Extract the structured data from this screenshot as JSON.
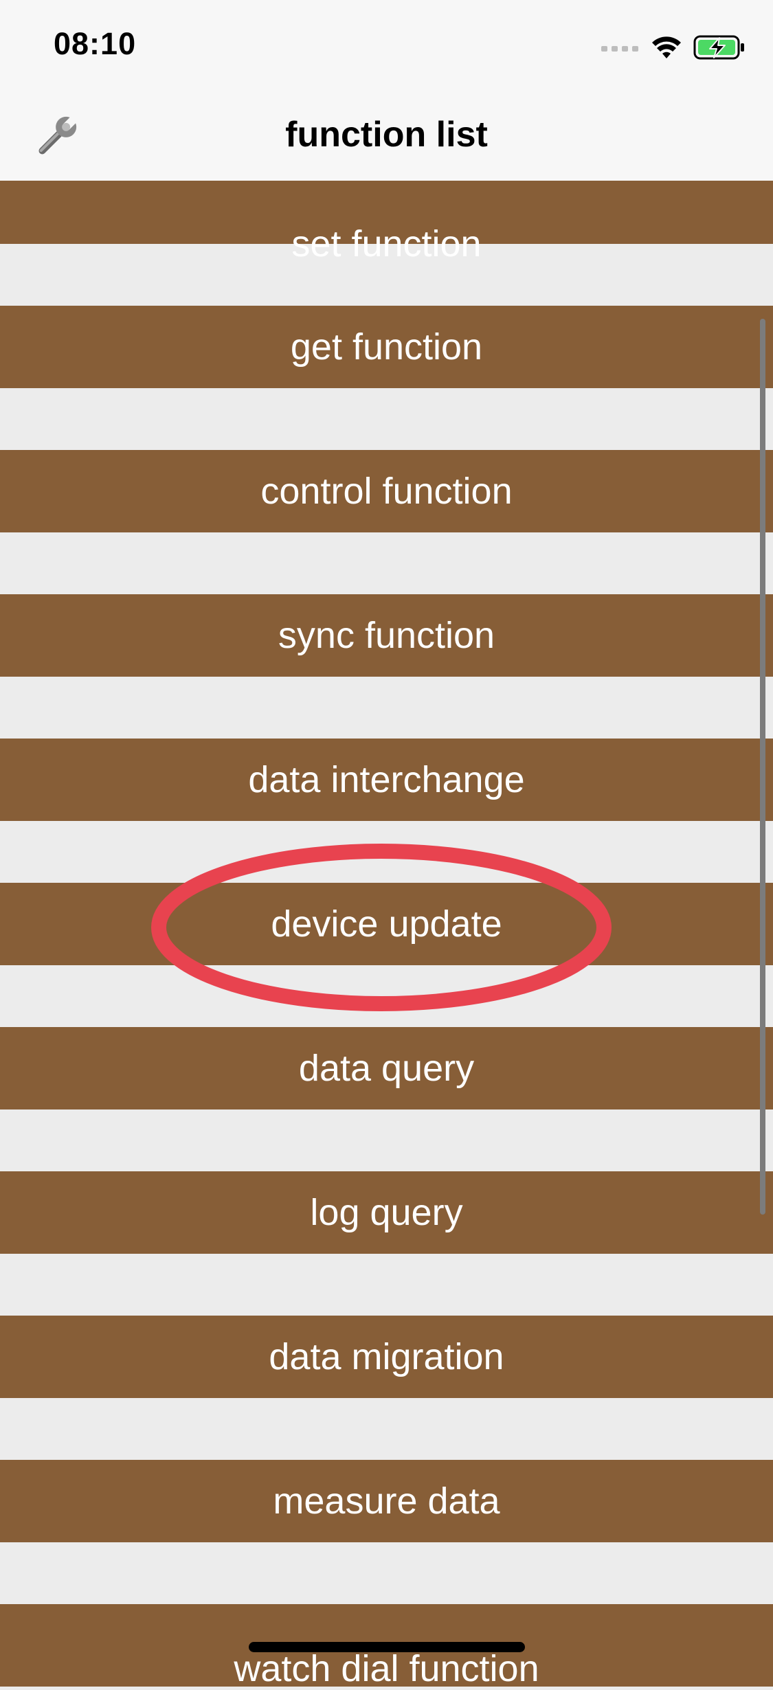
{
  "status_bar": {
    "time": "08:10"
  },
  "nav": {
    "title": "function list",
    "left_icon": "wrench-icon"
  },
  "list": {
    "items": [
      {
        "label": "set function"
      },
      {
        "label": "get function"
      },
      {
        "label": "control function"
      },
      {
        "label": "sync function"
      },
      {
        "label": "data interchange"
      },
      {
        "label": "device update"
      },
      {
        "label": "data query"
      },
      {
        "label": "log query"
      },
      {
        "label": "data migration"
      },
      {
        "label": "measure data"
      },
      {
        "label": "watch dial function"
      }
    ]
  },
  "highlight": {
    "target": "device update",
    "color": "#e8434f"
  },
  "colors": {
    "row": "#875e37",
    "background": "#ececec",
    "battery": "#4cd964"
  }
}
